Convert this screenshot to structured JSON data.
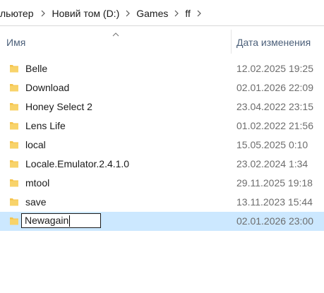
{
  "address_bar": {
    "crumbs": [
      "льютер",
      "Новий том (D:)",
      "Games",
      "ff"
    ]
  },
  "columns": {
    "name": "Имя",
    "date_modified": "Дата изменения",
    "sort": "ascending-by-name"
  },
  "rows": [
    {
      "name": "Belle",
      "date": "12.02.2025 19:25",
      "icon": "folder-icon"
    },
    {
      "name": "Download",
      "date": "02.01.2026 22:09",
      "icon": "folder-icon"
    },
    {
      "name": "Honey Select 2",
      "date": "23.04.2022 23:15",
      "icon": "folder-icon"
    },
    {
      "name": "Lens Life",
      "date": "01.02.2022 21:56",
      "icon": "folder-icon"
    },
    {
      "name": "local",
      "date": "15.05.2025 0:10",
      "icon": "folder-icon"
    },
    {
      "name": "Locale.Emulator.2.4.1.0",
      "date": "23.02.2024 1:34",
      "icon": "folder-icon"
    },
    {
      "name": "mtool",
      "date": "29.11.2025 19:18",
      "icon": "folder-icon"
    },
    {
      "name": "save",
      "date": "13.11.2023 15:44",
      "icon": "folder-icon"
    }
  ],
  "renaming_row": {
    "value": "Newagain",
    "date": "02.01.2026 23:00",
    "icon": "folder-icon"
  },
  "colors": {
    "selection": "#cce8ff",
    "folder": "#f5c34b",
    "header_text": "#4c607a"
  }
}
